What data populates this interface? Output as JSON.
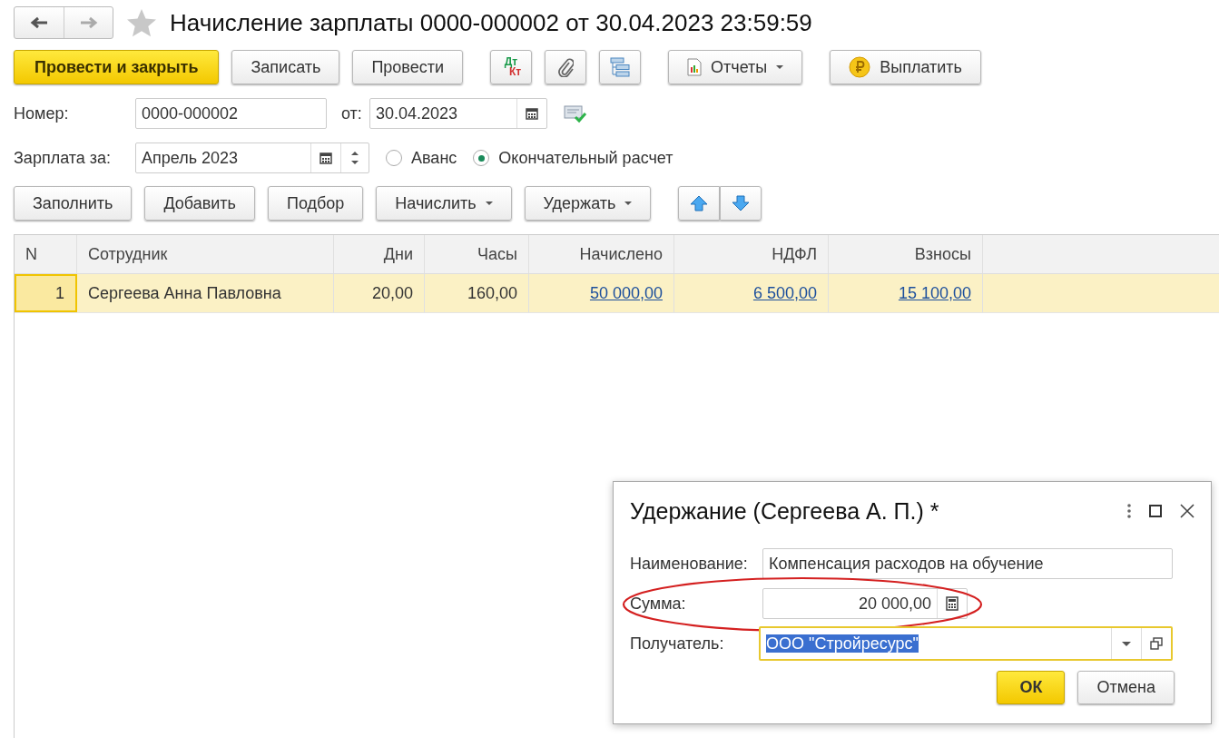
{
  "window": {
    "title": "Начисление зарплаты 0000-000002 от 30.04.2023 23:59:59"
  },
  "command_bar": [
    {
      "kind": "primary",
      "label": "Провести и закрыть"
    },
    {
      "kind": "button",
      "label": "Записать"
    },
    {
      "kind": "button",
      "label": "Провести"
    },
    {
      "kind": "debit-credit",
      "debit": "Дт",
      "credit": "Кт"
    },
    {
      "kind": "attach"
    },
    {
      "kind": "structure"
    },
    {
      "kind": "report-menu",
      "label": "Отчеты"
    },
    {
      "kind": "pay",
      "label": "Выплатить"
    }
  ],
  "number": {
    "label": "Номер:",
    "value": "0000-000002"
  },
  "date": {
    "label": "от:",
    "value": "30.04.2023"
  },
  "period": {
    "label": "Зарплата за:",
    "value": "Апрель 2023"
  },
  "payment_type": [
    {
      "label": "Аванс",
      "selected": false
    },
    {
      "label": "Окончательный расчет",
      "selected": true
    }
  ],
  "table_commands": [
    {
      "kind": "button",
      "label": "Заполнить"
    },
    {
      "kind": "button",
      "label": "Добавить"
    },
    {
      "kind": "button",
      "label": "Подбор"
    },
    {
      "kind": "menu",
      "label": "Начислить"
    },
    {
      "kind": "menu",
      "label": "Удержать"
    },
    {
      "kind": "move-up"
    },
    {
      "kind": "move-down"
    }
  ],
  "table": {
    "columns": [
      "N",
      "Сотрудник",
      "Дни",
      "Часы",
      "Начислено",
      "НДФЛ",
      "Взносы"
    ],
    "rows": [
      {
        "selected": true,
        "cells": [
          {
            "text": "1",
            "link": false
          },
          {
            "text": "Сергеева Анна Павловна",
            "link": false
          },
          {
            "text": "20,00",
            "link": false
          },
          {
            "text": "160,00",
            "link": false
          },
          {
            "text": "50 000,00",
            "link": true
          },
          {
            "text": "6 500,00",
            "link": true
          },
          {
            "text": "15 100,00",
            "link": true
          }
        ]
      }
    ]
  },
  "dialog": {
    "title": "Удержание (Сергеева А. П.) *",
    "fields": [
      {
        "kind": "text",
        "label": "Наименование:",
        "value": "Компенсация расходов на обучение",
        "highlighted": false,
        "focused": false,
        "text_selected": false
      },
      {
        "kind": "number",
        "label": "Сумма:",
        "value": "20 000,00",
        "highlighted": true,
        "focused": false,
        "text_selected": false
      },
      {
        "kind": "choice",
        "label": "Получатель:",
        "value": "ООО \"Стройресурс\"",
        "highlighted": false,
        "focused": true,
        "text_selected": true
      }
    ],
    "buttons": [
      {
        "label": "ОК",
        "default": true
      },
      {
        "label": "Отмена",
        "default": false
      }
    ]
  }
}
